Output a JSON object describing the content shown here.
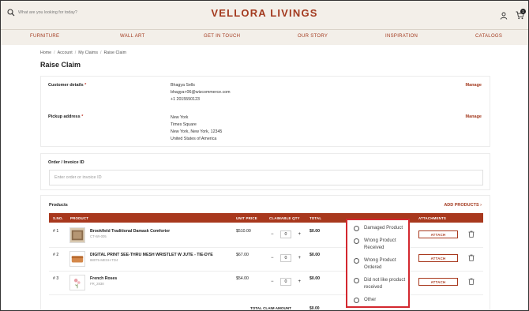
{
  "header": {
    "search_placeholder": "What are you looking for today?",
    "logo": "VELLORA  LIVINGS",
    "cart_count": "1"
  },
  "nav": [
    "FURNITURE",
    "WALL ART",
    "GET IN TOUCH",
    "OUR STORY",
    "INSPIRATION",
    "CATALOGS"
  ],
  "breadcrumb": [
    "Home",
    "Account",
    "My Claims",
    "Raise Claim"
  ],
  "page_title": "Raise Claim",
  "customer": {
    "label": "Customer details",
    "required": "*",
    "name": "Bhagya Sells",
    "email": "bhagya+06@wizcommerce.com",
    "phone": "+1 2015550123",
    "manage": "Manage"
  },
  "pickup": {
    "label": "Pickup address",
    "required": "*",
    "line1": "New York",
    "line2": "Times Square",
    "line3": "New York, New York, 12345",
    "line4": "United States of America",
    "manage": "Manage"
  },
  "order": {
    "label": "Order / Invoice ID",
    "placeholder": "Enter order or invoice ID"
  },
  "products": {
    "title": "Products",
    "add_label": "ADD PRODUCTS",
    "columns": {
      "sno": "S.NO.",
      "product": "PRODUCT",
      "unit_price": "UNIT PRICE",
      "claimable_qty": "CLAIMABLE QTY",
      "total": "TOTAL",
      "attachments": "ATTACHMENTS"
    },
    "rows": [
      {
        "sno": "# 1",
        "name": "Brookfield Traditional Damask Comforter",
        "sku": "CT-WI-005",
        "price": "$510.00",
        "qty": "0",
        "total": "$0.00",
        "attach": "ATTACH"
      },
      {
        "sno": "# 2",
        "name": "DIGITAL PRINT SEE-THRU MESH WRISTLET W JUTE - TIE-DYE",
        "sku": "88075-MESH-TD4",
        "price": "$67.00",
        "qty": "0",
        "total": "$0.00",
        "attach": "ATTACH"
      },
      {
        "sno": "# 3",
        "name": "French Roses",
        "sku": "FR_2838",
        "price": "$54.00",
        "qty": "0",
        "total": "$0.00",
        "attach": "ATTACH"
      }
    ],
    "total_label": "TOTAL CLAIM AMOUNT",
    "total_value": "$0.00"
  },
  "reason_options": [
    "Damaged Product",
    "Wrong Product Received",
    "Wrong Product Ordered",
    "Did not like product received",
    "Other"
  ],
  "colors": {
    "brand": "#a33a1f",
    "table_header": "#a8381d",
    "header_bg": "#f3efe9",
    "highlight_border": "#d3282f"
  }
}
